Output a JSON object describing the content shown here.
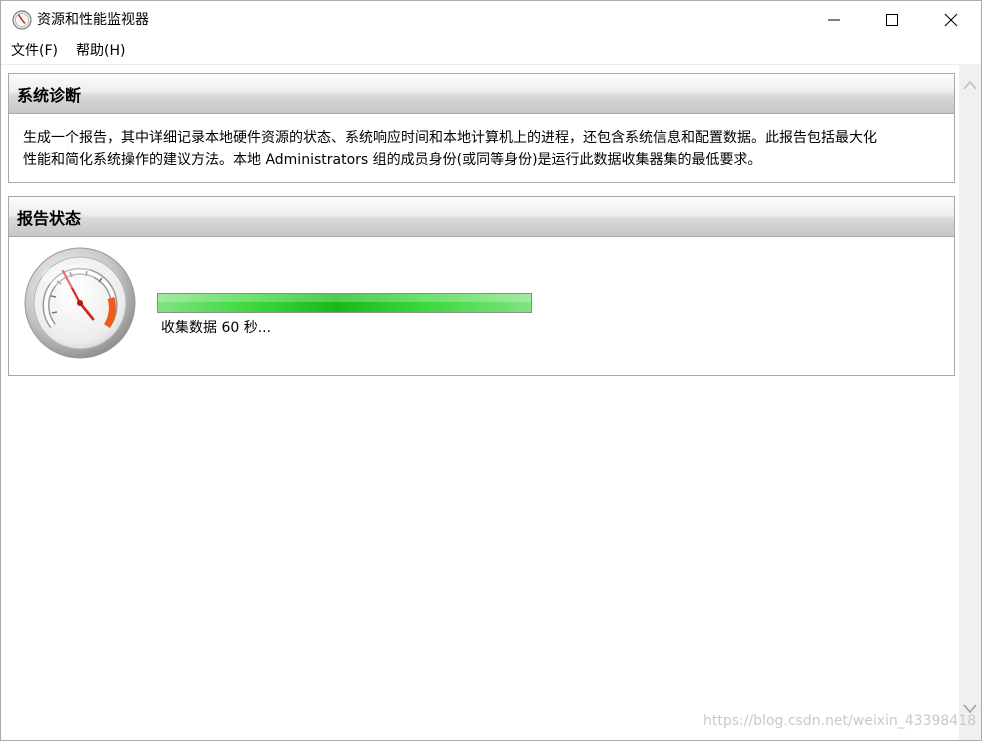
{
  "window": {
    "title": "资源和性能监视器",
    "app_icon": "gauge-icon",
    "buttons": {
      "minimize": "minimize-icon",
      "maximize": "maximize-icon",
      "close": "close-icon"
    }
  },
  "menu": {
    "file": "文件(F)",
    "help": "帮助(H)"
  },
  "diagnostics": {
    "header": "系统诊断",
    "line1": "生成一个报告，其中详细记录本地硬件资源的状态、系统响应时间和本地计算机上的进程，还包含系统信息和配置数据。此报告包括最大化",
    "line2": "性能和简化系统操作的建议方法。本地 Administrators 组的成员身份(或同等身份)是运行此数据收集器集的最低要求。"
  },
  "report_status": {
    "header": "报告状态",
    "gauge_icon": "speedometer-icon",
    "progress_fraction": 1.0,
    "progress_text": "收集数据 60 秒..."
  },
  "watermark": "https://blog.csdn.net/weixin_43398418",
  "colors": {
    "progress_green": "#19b919",
    "header_gradient_top": "#fcfcfc",
    "header_gradient_bottom": "#c6c6c6",
    "gauge_red": "#d9261c",
    "gauge_orange": "#f05a1a"
  }
}
